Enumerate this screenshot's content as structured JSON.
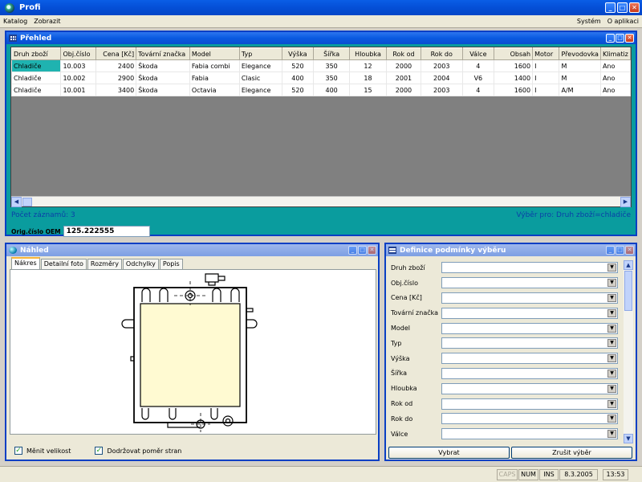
{
  "app": {
    "title": "Profi"
  },
  "menu": {
    "katalog": "Katalog",
    "zobrazit": "Zobrazit",
    "system": "Systém",
    "about": "O aplikaci"
  },
  "prehled": {
    "title": "Přehled",
    "columns": [
      "Druh zboží",
      "Obj.číslo",
      "Cena [Kč]",
      "Tovární značka",
      "Model",
      "Typ",
      "Výška",
      "Šířka",
      "Hloubka",
      "Rok od",
      "Rok do",
      "Válce",
      "Obsah",
      "Motor",
      "Převodovka",
      "Klimatiz"
    ],
    "rows": [
      [
        "Chladiče",
        "10.003",
        "2400",
        "Škoda",
        "Fabia combi",
        "Elegance",
        "520",
        "350",
        "12",
        "2000",
        "2003",
        "4",
        "1600",
        "I",
        "M",
        "Ano"
      ],
      [
        "Chladiče",
        "10.002",
        "2900",
        "Škoda",
        "Fabia",
        "Clasic",
        "400",
        "350",
        "18",
        "2001",
        "2004",
        "V6",
        "1400",
        "I",
        "M",
        "Ano"
      ],
      [
        "Chladiče",
        "10.001",
        "3400",
        "Škoda",
        "Octavia",
        "Elegance",
        "520",
        "400",
        "15",
        "2000",
        "2003",
        "4",
        "1600",
        "I",
        "A/M",
        "Ano"
      ]
    ],
    "record_count": "Počet záznamů: 3",
    "selection": "Výběr pro:  Druh zboží=chladiče",
    "oem_label": "Orig.číslo OEM",
    "oem_value": "125.222555"
  },
  "nahled": {
    "title": "Náhled",
    "tabs": [
      "Nákres",
      "Detailní foto",
      "Rozměry",
      "Odchylky",
      "Popis"
    ],
    "chk_resize": "Měnit velikost",
    "chk_ratio": "Dodržovat poměr stran"
  },
  "definice": {
    "title": "Definice podmínky výběru",
    "fields": [
      "Druh zboží",
      "Obj.číslo",
      "Cena [Kč]",
      "Tovární značka",
      "Model",
      "Typ",
      "Výška",
      "Šířka",
      "Hloubka",
      "Rok od",
      "Rok do",
      "Válce"
    ],
    "btn_select": "Vybrat",
    "btn_cancel": "Zrušit výběr"
  },
  "status": {
    "caps": "CAPS",
    "num": "NUM",
    "ins": "INS",
    "date": "8.3.2005",
    "time": "13:53"
  },
  "colors": {
    "title_blue": "#0550d8",
    "teal": "#0a9c9e",
    "selected_cell": "#1fb3b0",
    "info_text": "#0a3fa8"
  },
  "icons": [
    "app-icon",
    "grid-window-icon",
    "globe-icon",
    "form-icon",
    "minimize-icon",
    "maximize-icon",
    "close-icon",
    "scroll-left-icon",
    "scroll-right-icon",
    "scroll-up-icon",
    "scroll-down-icon",
    "dropdown-arrow-icon",
    "checkbox-checked-icon"
  ]
}
